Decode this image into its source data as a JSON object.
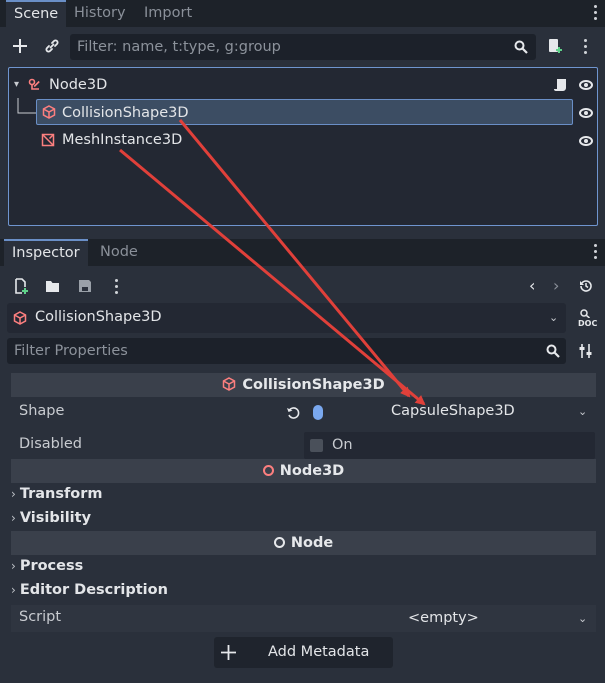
{
  "scene_dock": {
    "tabs": [
      {
        "label": "Scene",
        "active": true
      },
      {
        "label": "History",
        "active": false
      },
      {
        "label": "Import",
        "active": false
      }
    ],
    "filter_placeholder": "Filter: name, t:type, g:group",
    "tree": [
      {
        "name": "Node3D",
        "icon": "node3d-icon",
        "has_script": true,
        "visible": true,
        "selected": false
      },
      {
        "name": "CollisionShape3D",
        "icon": "collision-shape-icon",
        "visible": true,
        "selected": true
      },
      {
        "name": "MeshInstance3D",
        "icon": "mesh-instance-icon",
        "visible": true,
        "selected": false
      }
    ]
  },
  "inspector_dock": {
    "tabs": [
      {
        "label": "Inspector",
        "active": true
      },
      {
        "label": "Node",
        "active": false
      }
    ],
    "object_path": "CollisionShape3D",
    "filter_placeholder": "Filter Properties",
    "sections": {
      "collision": "CollisionShape3D",
      "node3d": "Node3D",
      "node": "Node"
    },
    "properties": {
      "shape_label": "Shape",
      "shape_value": "CapsuleShape3D",
      "disabled_label": "Disabled",
      "disabled_value": "On",
      "disabled_checked": false,
      "script_label": "Script",
      "script_value": "<empty>"
    },
    "groups": {
      "transform": "Transform",
      "visibility": "Visibility",
      "process": "Process",
      "editor_description": "Editor Description"
    },
    "add_metadata_label": "Add Metadata"
  },
  "colors": {
    "accent_blue": "#6a8fc7",
    "node3d_red": "#fc7f7f",
    "arrow_red": "#e0403a"
  }
}
